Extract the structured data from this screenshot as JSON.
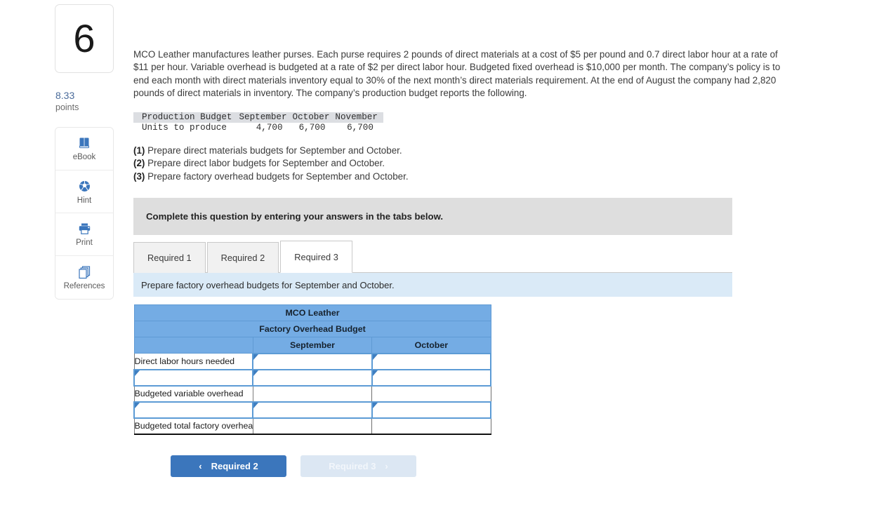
{
  "question": {
    "number": "6",
    "points_value": "8.33",
    "points_label": "points",
    "body": "MCO Leather manufactures leather purses. Each purse requires 2 pounds of direct materials at a cost of $5 per pound and 0.7 direct labor hour at a rate of $11 per hour. Variable overhead is budgeted at a rate of $2 per direct labor hour. Budgeted fixed overhead is $10,000 per month. The company’s policy is to end each month with direct materials inventory equal to 30% of the next month’s direct materials requirement. At the end of August the company had 2,820 pounds of direct materials in inventory. The company’s production budget reports the following."
  },
  "tools": [
    {
      "label": "eBook",
      "icon": "book-icon"
    },
    {
      "label": "Hint",
      "icon": "globe-icon"
    },
    {
      "label": "Print",
      "icon": "printer-icon"
    },
    {
      "label": "References",
      "icon": "pages-icon"
    }
  ],
  "production_budget": {
    "header": [
      "Production Budget",
      "September",
      "October",
      "November"
    ],
    "row_label": "Units to produce",
    "row_values": [
      "4,700",
      "6,700",
      "6,700"
    ]
  },
  "requirements": [
    {
      "num": "(1)",
      "text": " Prepare direct materials budgets for September and October."
    },
    {
      "num": "(2)",
      "text": " Prepare direct labor budgets for September and October."
    },
    {
      "num": "(3)",
      "text": " Prepare factory overhead budgets for September and October."
    }
  ],
  "complete_banner": "Complete this question by entering your answers in the tabs below.",
  "tabs": [
    {
      "label": "Required 1",
      "active": false
    },
    {
      "label": "Required 2",
      "active": false
    },
    {
      "label": "Required 3",
      "active": true
    }
  ],
  "sub_bar": "Prepare factory overhead budgets for September and October.",
  "answer_table": {
    "title": "MCO Leather",
    "subtitle": "Factory Overhead Budget",
    "columns": [
      "September",
      "October"
    ],
    "rows": [
      {
        "label": "Direct labor hours needed",
        "label_editable": false,
        "september": "",
        "october": "",
        "values_editable": true
      },
      {
        "label": "",
        "label_editable": true,
        "september": "",
        "october": "",
        "values_editable": true
      },
      {
        "label": "Budgeted variable overhead",
        "label_editable": false,
        "september": "",
        "october": "",
        "values_editable": false
      },
      {
        "label": "",
        "label_editable": true,
        "september": "",
        "october": "",
        "values_editable": true
      },
      {
        "label": "Budgeted total factory overhead",
        "label_editable": false,
        "september": "",
        "october": "",
        "values_editable": false
      }
    ]
  },
  "nav": {
    "prev_label": "Required 2",
    "prev_chevron": "‹",
    "next_label": "Required 3",
    "next_chevron": "›"
  },
  "colors": {
    "accent_blue": "#3b76bc",
    "table_header_blue": "#74ace4",
    "sub_bar_blue": "#daeaf7",
    "banner_gray": "#dedede",
    "input_border_blue": "#5c9bd5"
  }
}
